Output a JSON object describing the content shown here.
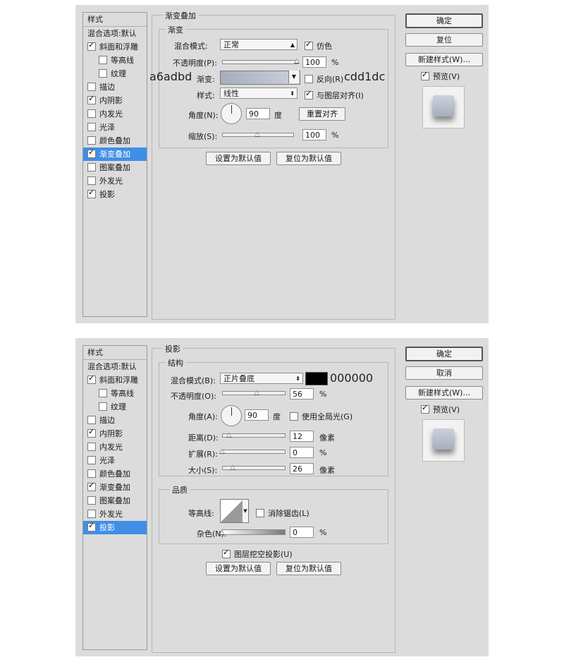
{
  "sidebar": {
    "title": "样式",
    "blend_options": "混合选项:默认",
    "items": [
      {
        "label": "斜面和浮雕",
        "checked": true,
        "indent": false
      },
      {
        "label": "等高线",
        "checked": false,
        "indent": true
      },
      {
        "label": "纹理",
        "checked": false,
        "indent": true
      },
      {
        "label": "描边",
        "checked": false,
        "indent": false
      },
      {
        "label": "内阴影",
        "checked": true,
        "indent": false
      },
      {
        "label": "内发光",
        "checked": false,
        "indent": false
      },
      {
        "label": "光泽",
        "checked": false,
        "indent": false
      },
      {
        "label": "颜色叠加",
        "checked": false,
        "indent": false
      },
      {
        "label": "渐变叠加",
        "checked": true,
        "indent": false
      },
      {
        "label": "图案叠加",
        "checked": false,
        "indent": false
      },
      {
        "label": "外发光",
        "checked": false,
        "indent": false
      },
      {
        "label": "投影",
        "checked": true,
        "indent": false
      }
    ]
  },
  "right": {
    "ok": "确定",
    "reset": "复位",
    "cancel": "取消",
    "new_style": "新建样式(W)...",
    "preview": "预览(V)"
  },
  "gradient": {
    "section": "渐变叠加",
    "group": "渐变",
    "blend_mode_label": "混合模式:",
    "blend_mode": "正常",
    "dither": "仿色",
    "opacity_label": "不透明度(P):",
    "opacity": "100",
    "opacity_level": 1.0,
    "gradient_label": "渐变:",
    "color_start": "a6adbd",
    "color_end": "cdd1dc",
    "reverse": "反向(R)",
    "style_label": "样式:",
    "style": "线性",
    "align": "与图层对齐(I)",
    "angle_label": "角度(N):",
    "angle": "90",
    "deg": "度",
    "reset_align": "重置对齐",
    "scale_label": "缩放(S):",
    "scale": "100",
    "scale_level": 0.5,
    "set_default": "设置为默认值",
    "reset_default": "复位为默认值",
    "pct": "%"
  },
  "shadow": {
    "section": "投影",
    "group_structure": "结构",
    "blend_mode_label": "混合模式(B):",
    "blend_mode": "正片叠底",
    "color": "000000",
    "opacity_label": "不透明度(O):",
    "opacity": "56",
    "opacity_level": 0.56,
    "angle_label": "角度(A):",
    "angle": "90",
    "deg": "度",
    "global_light": "使用全局光(G)",
    "distance_label": "距离(D):",
    "distance": "12",
    "spread_label": "扩展(R):",
    "spread": "0",
    "size_label": "大小(S):",
    "size": "26",
    "px": "像素",
    "pct": "%",
    "group_quality": "品质",
    "contour_label": "等高线:",
    "antialias": "消除锯齿(L)",
    "noise_label": "杂色(N):",
    "noise": "0",
    "knockout": "图层挖空投影(U)",
    "set_default": "设置为默认值",
    "reset_default": "复位为默认值"
  },
  "colors": {
    "panel_bg": "#dcdcdc",
    "selection": "#3f8fe6",
    "gradient_start": "#a6adbd",
    "gradient_end": "#cdd1dc",
    "shadow_color": "#000000"
  }
}
